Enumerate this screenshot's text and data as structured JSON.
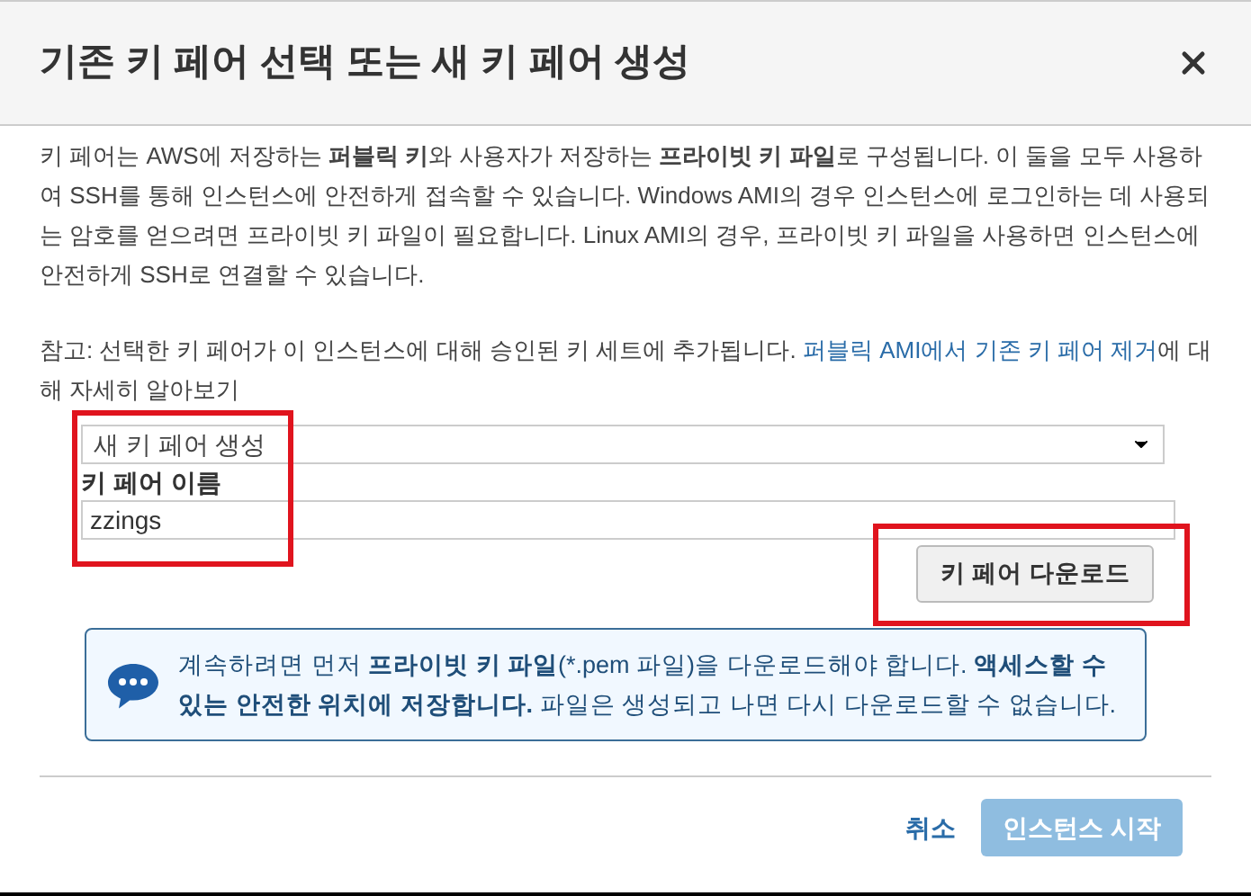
{
  "dialog": {
    "title": "기존 키 페어 선택 또는 새 키 페어 생성"
  },
  "intro": "키 페어는 AWS에 저장하는 **퍼블릭 키**와 사용자가 저장하는 **프라이빗 키 파일**로 구성됩니다. 이 둘을 모두 사용하여 SSH를 통해 인스턴스에 안전하게 접속할 수 있습니다. Windows AMI의 경우 인스턴스에 로그인하는 데 사용되는 암호를 얻으려면 프라이빗 키 파일이 필요합니다. Linux AMI의 경우, 프라이빗 키 파일을 사용하면 인스턴스에 안전하게 SSH로 연결할 수 있습니다.",
  "note": {
    "text": "참고: 선택한 키 페어가 이 인스턴스에 대해 승인된 키 세트에 추가됩니다.",
    "link": "퍼블릭 AMI에서 기존 키 페어 제거",
    "suffix": "에 대해 자세히 알아보기"
  },
  "key_pair_form": {
    "highlighted": true,
    "select_value": "새 키 페어 생성",
    "name_label": "키 페어 이름",
    "name_value": "zzings"
  },
  "download_button": {
    "label": "키 페어 다운로드",
    "highlighted": true
  },
  "alert": "계속하려면 먼저 **프라이빗 키 파일**(*.pem 파일)을 다운로드해야 합니다. **액세스할 수 있는 안전한 위치에 저장합니다.** 파일은 생성되고 나면 다시 다운로드할 수 없습니다.",
  "footer": {
    "cancel": "취소",
    "launch": {
      "label": "인스턴스 시작",
      "disabled": true
    }
  }
}
